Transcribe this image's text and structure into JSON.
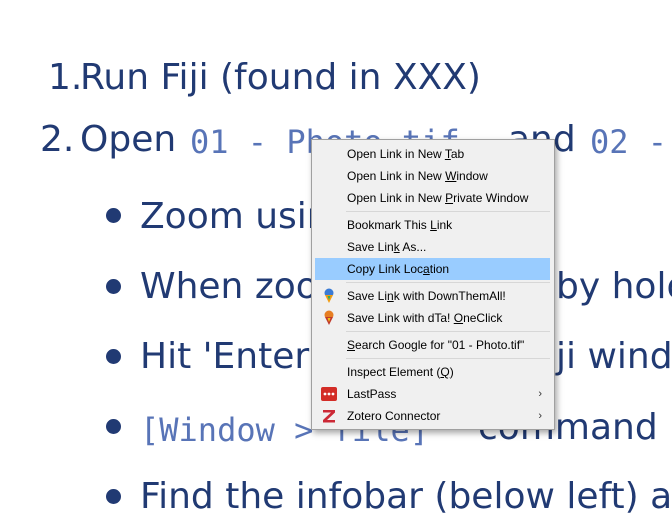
{
  "slide": {
    "line1_num": "1.",
    "line1_text": "Run Fiji (found in XXX)",
    "line2_num": "2.",
    "line2_open": "Open",
    "line2_code1": "01 - Photo.tif",
    "line2_and": "and",
    "line2_code2": "02 -",
    "bullet1": "Zoom usin",
    "bullet2_a": "When zoo",
    "bullet2_b": "by holo",
    "bullet3_a": "Hit 'Enter'",
    "bullet3_b": "ji wind",
    "bullet4_code": "[Window > file]",
    "bullet4_text": "command",
    "bullet5": "Find the infobar (below left) a"
  },
  "context_menu": {
    "items": [
      {
        "pre": "Open Link in New ",
        "key": "T",
        "post": "ab"
      },
      {
        "pre": "Open Link in New ",
        "key": "W",
        "post": "indow"
      },
      {
        "pre": "Open Link in New ",
        "key": "P",
        "post": "rivate Window"
      },
      {
        "pre": "Bookmark This ",
        "key": "L",
        "post": "ink"
      },
      {
        "pre": "Save Lin",
        "key": "k",
        "post": " As..."
      },
      {
        "pre": "Copy Link Loc",
        "key": "a",
        "post": "tion"
      },
      {
        "pre": "Save Li",
        "key": "n",
        "post": "k with DownThemAll!"
      },
      {
        "pre": "Save Link with dTa! ",
        "key": "O",
        "post": "neClick"
      },
      {
        "pre": "",
        "key": "S",
        "post": "earch Google for \"01 - Photo.tif\""
      },
      {
        "pre": "Inspect Element (",
        "key": "Q",
        "post": ")"
      },
      {
        "pre": "LastPass",
        "key": "",
        "post": ""
      },
      {
        "pre": "Zotero Connector",
        "key": "",
        "post": ""
      }
    ],
    "submenu_arrow": "›",
    "highlight_color": "#99ccff"
  },
  "colors": {
    "slide_text": "#213a73",
    "slide_code": "#5874b7",
    "lastpass_red": "#d32d27",
    "zotero_red": "#cc2936"
  }
}
